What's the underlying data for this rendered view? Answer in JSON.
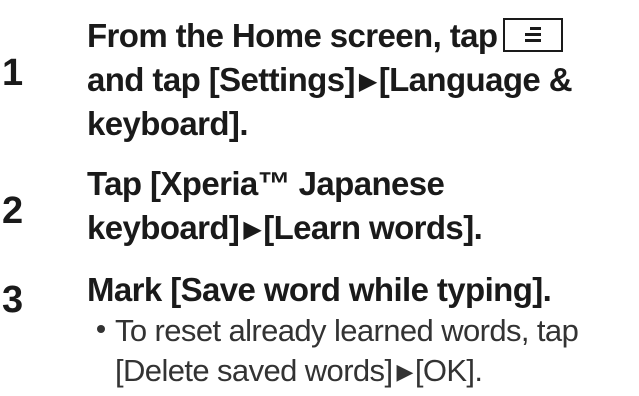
{
  "steps": [
    {
      "number": "1",
      "line1_before": "From the Home screen, tap",
      "menu_key_icon": "menu-key-icon",
      "line2_part1": "and tap [Settings]",
      "line2_arrow": "▶",
      "line2_part2": "[Language &",
      "line3": "keyboard]."
    },
    {
      "number": "2",
      "line1": "Tap [Xperia™ Japanese",
      "line2_part1": "keyboard]",
      "line2_arrow": "▶",
      "line2_part2": "[Learn words]."
    },
    {
      "number": "3",
      "line1": "Mark [Save word while typing].",
      "bullet_line1": "To reset already learned words, tap",
      "bullet_line2_part1": "[Delete saved words]",
      "bullet_line2_arrow": "▶",
      "bullet_line2_part2": "[OK]."
    }
  ]
}
